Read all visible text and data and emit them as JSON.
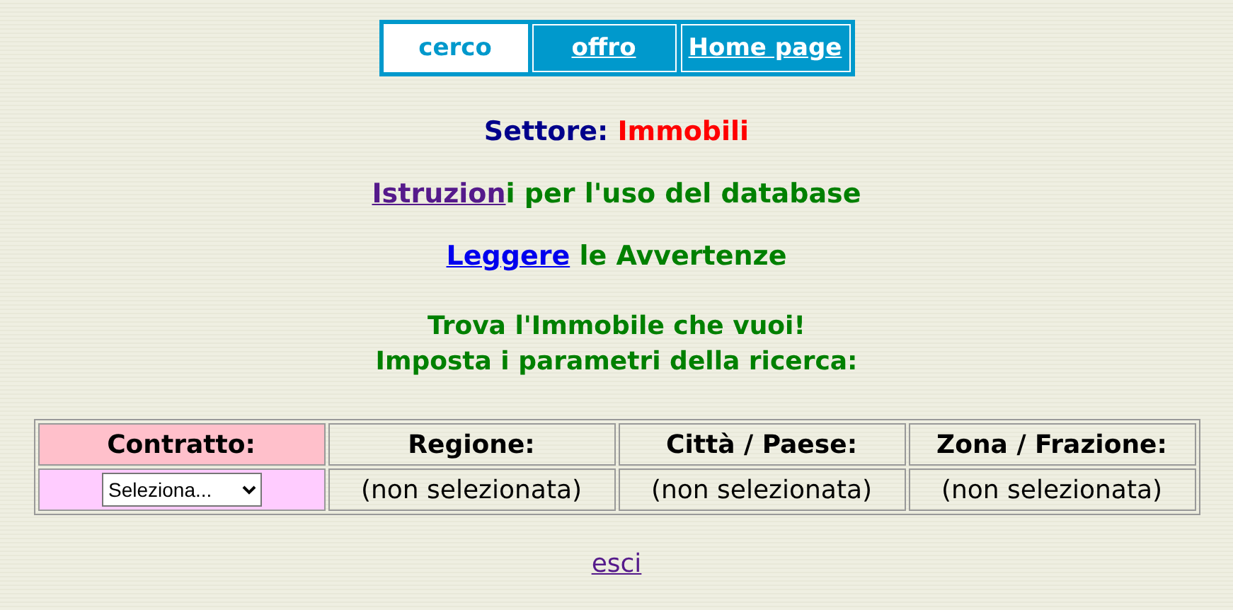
{
  "tabs": [
    {
      "label": "cerco",
      "selected": true
    },
    {
      "label": "offro",
      "selected": false
    },
    {
      "label": "Home page",
      "selected": false
    }
  ],
  "sector": {
    "label": "Settore:",
    "value": "Immobili"
  },
  "lines": [
    {
      "link": "Istruzion",
      "text": "i per l'uso del database",
      "visited": true
    },
    {
      "link": "Leggere",
      "text": " le Avvertenze",
      "visited": false
    }
  ],
  "intro": [
    "Trova l'Immobile che vuoi!",
    "Imposta i parametri della ricerca:"
  ],
  "table": {
    "columns": [
      "Contratto:",
      "Regione:",
      "Città / Paese:",
      "Zona / Frazione:"
    ],
    "row": [
      {
        "kind": "select",
        "value": "Seleziona..."
      },
      {
        "kind": "text",
        "value": "(non selezionata)"
      },
      {
        "kind": "text",
        "value": "(non selezionata)"
      },
      {
        "kind": "text",
        "value": "(non selezionata)"
      }
    ]
  },
  "exit": {
    "label": "esci",
    "visited": true
  }
}
